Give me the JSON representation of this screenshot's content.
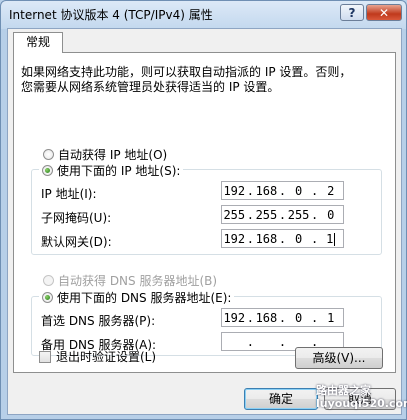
{
  "window": {
    "title": "Internet 协议版本 4 (TCP/IPv4) 属性",
    "help_label": "?",
    "close_label": "✕"
  },
  "tabs": [
    {
      "label": "常规"
    }
  ],
  "description": {
    "line1": "如果网络支持此功能，则可以获取自动指派的 IP 设置。否则，",
    "line2": "您需要从网络系统管理员处获得适当的 IP 设置。"
  },
  "ip_mode": {
    "auto_label": "自动获得 IP 地址(O)",
    "manual_label": "使用下面的 IP 地址(S):",
    "selected": "manual"
  },
  "ip_fields": [
    {
      "label": "IP 地址(I):",
      "octets": [
        "192",
        "168",
        "0",
        "2"
      ]
    },
    {
      "label": "子网掩码(U):",
      "octets": [
        "255",
        "255",
        "255",
        "0"
      ]
    },
    {
      "label": "默认网关(D):",
      "octets": [
        "192",
        "168",
        "0",
        "1"
      ]
    }
  ],
  "dns_mode": {
    "auto_label": "自动获得 DNS 服务器地址(B)",
    "manual_label": "使用下面的 DNS 服务器地址(E):",
    "selected": "manual",
    "auto_disabled": true
  },
  "dns_fields": [
    {
      "label": "首选 DNS 服务器(P):",
      "octets": [
        "192",
        "168",
        "0",
        "1"
      ]
    },
    {
      "label": "备用 DNS 服务器(A):",
      "octets": [
        "",
        "",
        "",
        ""
      ]
    }
  ],
  "validate_on_exit": {
    "label": "退出时验证设置(L)",
    "checked": false
  },
  "advanced_button": "高级(V)...",
  "ok_button": "确定",
  "cancel_button": "取消",
  "watermark": {
    "line1": "路由器之家",
    "line2": "luyouqi520.com"
  }
}
